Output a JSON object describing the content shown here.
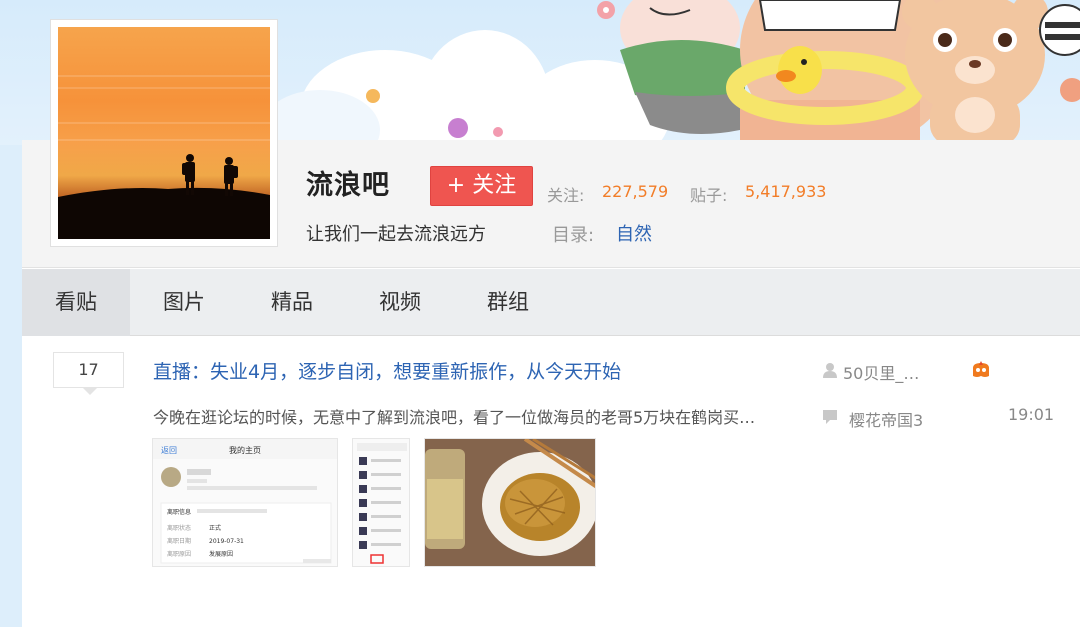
{
  "forum": {
    "name": "流浪吧",
    "slogan": "让我们一起去流浪远方",
    "follow_label": "+ 关注",
    "followers_label": "关注:",
    "followers_value": "227,579",
    "posts_label": "贴子:",
    "posts_value": "5,417,933",
    "directory_label": "目录:",
    "directory_value": "自然"
  },
  "tabs": [
    "看贴",
    "图片",
    "精品",
    "视频",
    "群组"
  ],
  "thread": {
    "reply_count": "17",
    "title": "直播：失业4月，逐步自闭，想要重新振作，从今天开始",
    "abstract": "今晚在逛论坛的时候，无意中了解到流浪吧，看了一位做海员的老哥5万块在鹤岗买…",
    "author": "50贝里_…",
    "last_replier": "樱花帝国3",
    "last_reply_time": "19:01"
  },
  "thumbnails": {
    "profile": {
      "back": "返回",
      "title": "我的主页",
      "section": "离职信息",
      "row1_label": "离职状态",
      "row1_value": "正式",
      "row2_label": "离职日期",
      "row2_value": "2019-07-31",
      "row3_label": "离职原因",
      "row3_value": "发展原因"
    }
  },
  "colors": {
    "accent_blue": "#2d64b3",
    "follow_red": "#ef5550",
    "stat_orange": "#f27d28"
  },
  "icons": [
    "user-icon",
    "comment-icon",
    "hot-post-icon"
  ]
}
